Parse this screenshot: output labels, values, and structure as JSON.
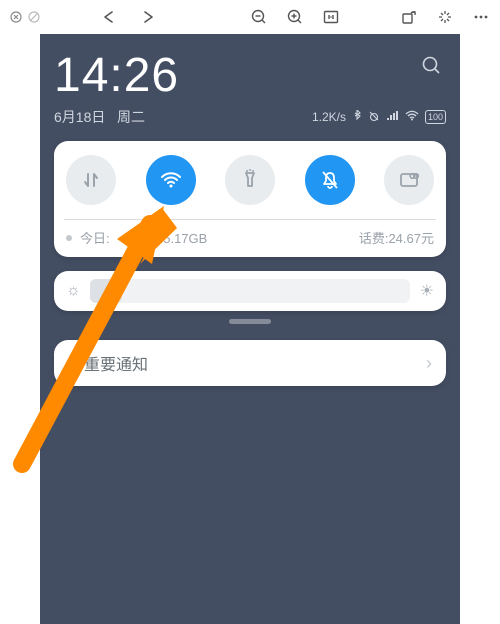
{
  "toolbar": {
    "close": "close-icon",
    "cancel": "cancel-icon",
    "back": "back-icon",
    "forward": "forward-icon",
    "zoom_out": "zoom-out-icon",
    "zoom_in": "zoom-in-icon",
    "fit": "fit-1to1-icon",
    "rotate": "rotate-icon",
    "sparkle": "effects-icon",
    "more": "more-icon"
  },
  "screenshot": {
    "clock": "14:26",
    "date": "6月18日",
    "weekday": "周二",
    "net_speed": "1.2K/s",
    "battery": "100",
    "quick_toggles": {
      "data": {
        "name": "mobile-data",
        "active": false
      },
      "wifi": {
        "name": "wifi",
        "active": true
      },
      "torch": {
        "name": "flashlight",
        "active": false
      },
      "dnd": {
        "name": "do-not-disturb",
        "active": true
      },
      "screenshot": {
        "name": "screenshot",
        "active": false
      }
    },
    "usage": {
      "today_label": "今日:",
      "remain_label": "剩余:5.17GB",
      "bill_label": "话费:24.67元"
    },
    "unimportant_notif": "不重要通知"
  }
}
